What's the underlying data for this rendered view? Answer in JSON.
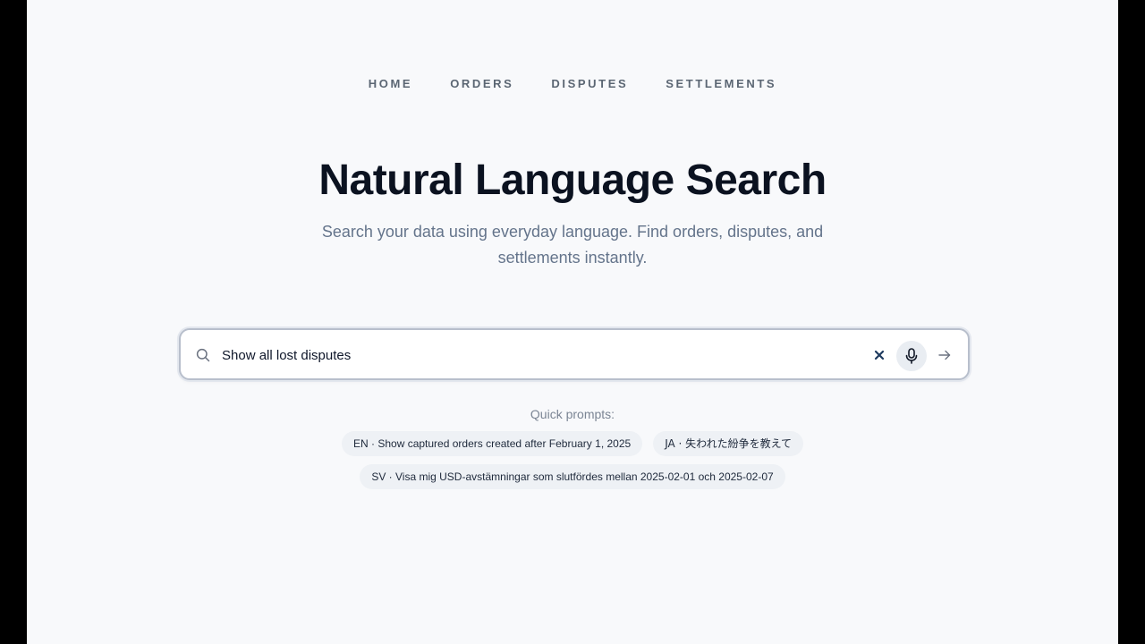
{
  "nav": {
    "items": [
      {
        "label": "HOME"
      },
      {
        "label": "ORDERS"
      },
      {
        "label": "DISPUTES"
      },
      {
        "label": "SETTLEMENTS"
      }
    ]
  },
  "hero": {
    "title": "Natural Language Search",
    "subtitle": "Search your data using everyday language. Find orders, disputes, and settlements instantly."
  },
  "search": {
    "value": "Show all lost disputes",
    "icons": {
      "search": "search-icon",
      "clear": "close-icon",
      "mic": "microphone-icon",
      "submit": "arrow-right-icon"
    }
  },
  "quick_prompts": {
    "label": "Quick prompts:",
    "items": [
      {
        "text": "EN · Show captured orders created after February 1, 2025"
      },
      {
        "text": "JA · 失われた紛争を教えて"
      },
      {
        "text": "SV · Visa mig USD-avstämningar som slutfördes mellan 2025-02-01 och 2025-02-07"
      }
    ]
  },
  "colors": {
    "page_bg": "#f8f9fb",
    "title": "#0b1220",
    "muted": "#64748b",
    "chip_bg": "#eef1f5",
    "search_border": "#b8bfcc"
  }
}
